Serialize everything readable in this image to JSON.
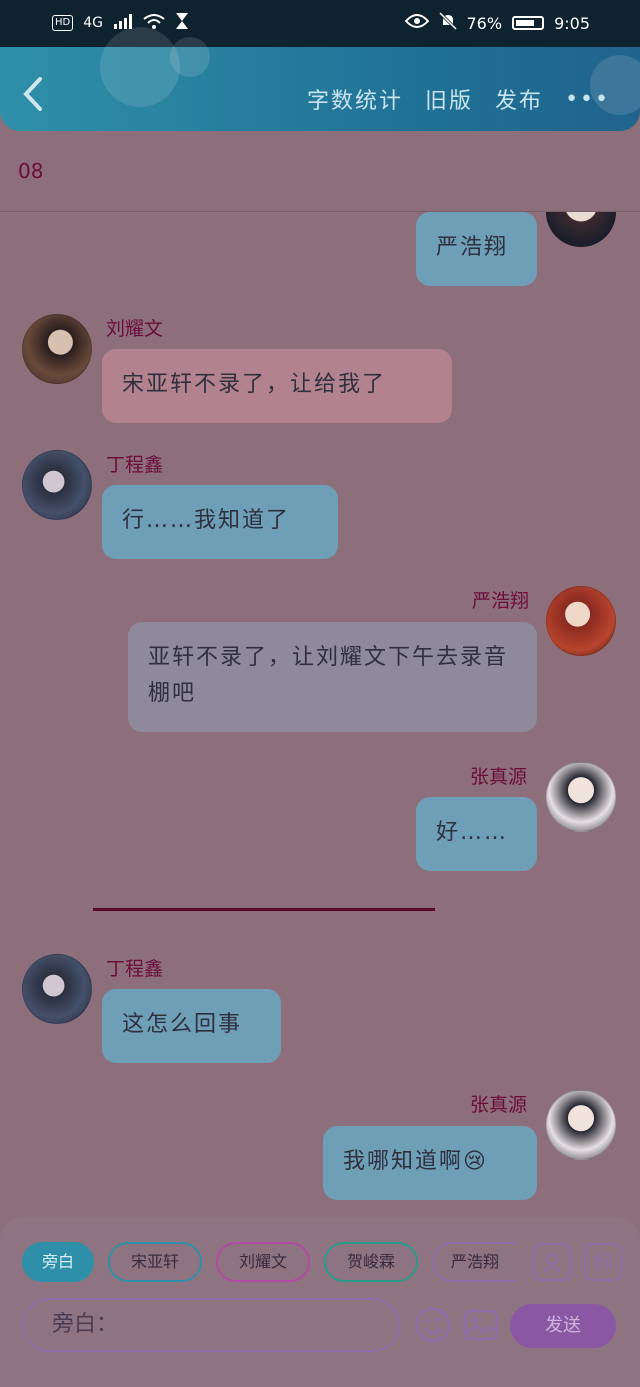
{
  "status_bar": {
    "hd": "HD",
    "network": "4G",
    "battery": "76%",
    "battery_level": 0.76,
    "time": "9:05"
  },
  "header": {
    "actions": [
      "字数统计",
      "旧版",
      "发布"
    ],
    "more": "•••"
  },
  "chapter": "08",
  "messages": [
    {
      "speaker": "",
      "side": "right",
      "text": "严浩翔",
      "color": "#6e9fb7"
    },
    {
      "speaker": "刘耀文",
      "side": "left",
      "text": "宋亚轩不录了，让给我了",
      "color": "#b2838f"
    },
    {
      "speaker": "丁程鑫",
      "side": "left",
      "text": "行……我知道了",
      "color": "#6e9fb7"
    },
    {
      "speaker": "严浩翔",
      "side": "right",
      "text": "亚轩不录了，让刘耀文下午去录音棚吧",
      "color": "#8e8a9a"
    },
    {
      "speaker": "张真源",
      "side": "right",
      "text": "好……",
      "color": "#6e9fb7"
    },
    {
      "speaker": "丁程鑫",
      "side": "left",
      "text": "这怎么回事",
      "color": "#6e9fb7"
    },
    {
      "speaker": "张真源",
      "side": "right",
      "text": "我哪知道啊",
      "color": "#6e9fb7",
      "emoji": "😢"
    }
  ],
  "composer": {
    "chips": [
      "旁白",
      "宋亚轩",
      "刘耀文",
      "贺峻霖",
      "严浩翔"
    ],
    "chip_colors": [
      "#2f8fa8",
      "#2f8fa8",
      "#b24aa3",
      "#2a9a8a",
      "#8f6da8"
    ],
    "tool_label": "标",
    "input_value": "旁白：",
    "send": "发送"
  }
}
